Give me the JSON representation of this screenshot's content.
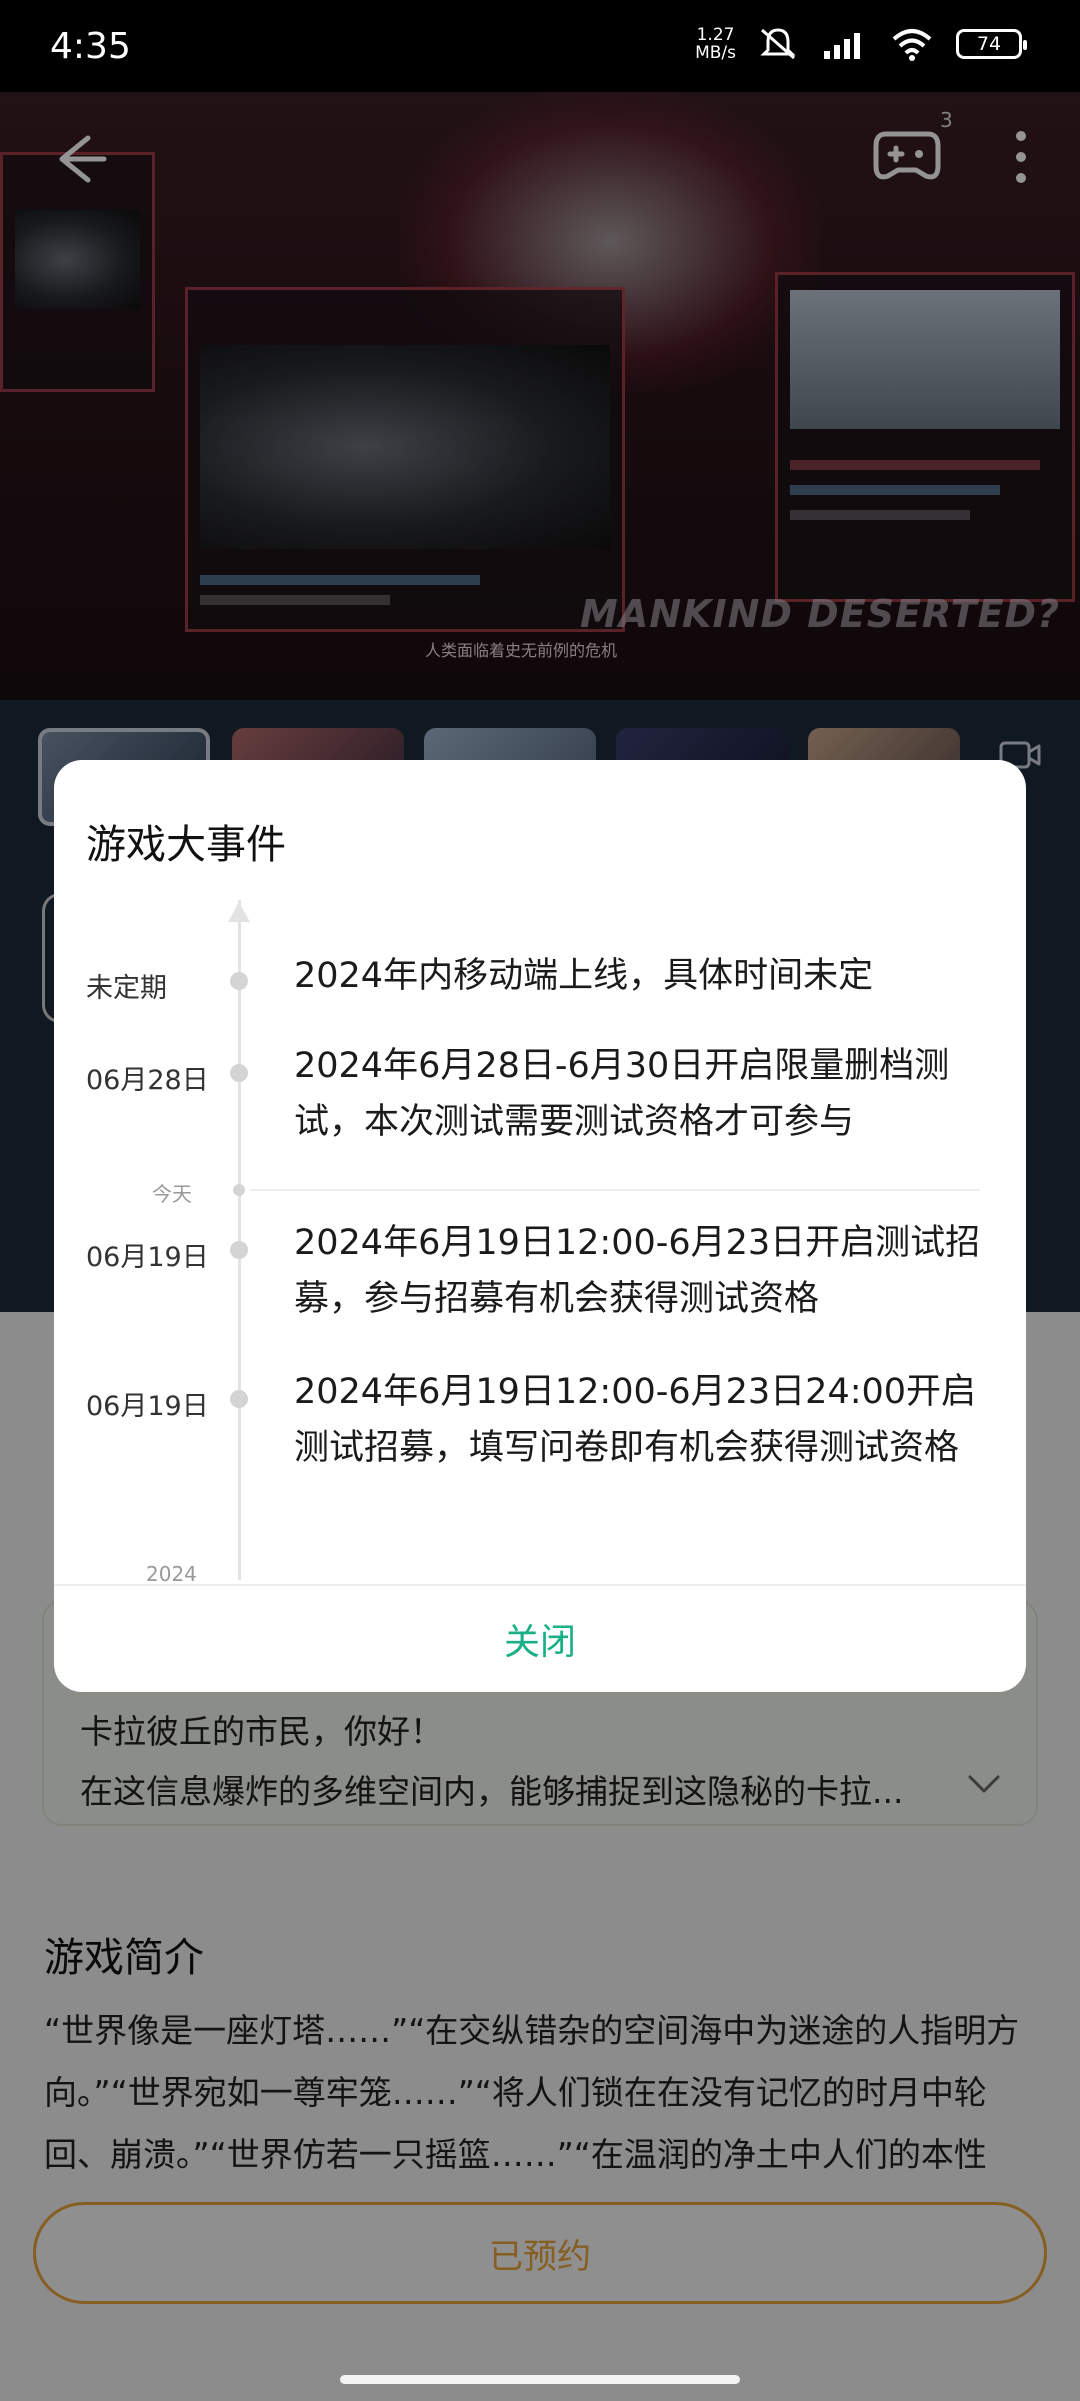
{
  "status_bar": {
    "time": "4:35",
    "net_speed_value": "1.27",
    "net_speed_unit": "MB/s",
    "battery": "74",
    "icons": [
      "mute-icon",
      "hd-signal-icon",
      "wifi-icon",
      "battery-icon"
    ]
  },
  "hero": {
    "caption": "人类面临着史无前例的危机",
    "title_art": "MANKIND DESERTED?",
    "controller_badge": "3",
    "icons": [
      "back-arrow-icon",
      "game-controller-icon",
      "more-vertical-icon"
    ]
  },
  "dialog": {
    "title": "游戏大事件",
    "events": [
      {
        "date": "未定期",
        "text": "2024年内移动端上线，具体时间未定"
      },
      {
        "date": "06月28日",
        "text": "2024年6月28日-6月30日开启限量删档测试，本次测试需要测试资格才可参与"
      },
      {
        "date": "06月19日",
        "text": "2024年6月19日12:00-6月23日开启测试招募，参与招募有机会获得测试资格"
      },
      {
        "date": "06月19日",
        "text": "2024年6月19日12:00-6月23日24:00开启测试招募，填写问卷即有机会获得测试资格"
      }
    ],
    "today_label": "今天",
    "year_label": "2024",
    "close_label": "关闭"
  },
  "page": {
    "welcome_line1": "卡拉彼丘的市民，你好！",
    "welcome_line2": "在这信息爆炸的多维空间内，能够捕捉到这隐秘的卡拉...",
    "intro_title": "游戏简介",
    "intro_body": "“世界像是一座灯塔……”“在交纵错杂的空间海中为迷途的人指明方向。”“世界宛如一尊牢笼……”“将人们锁在在没有记忆的时月中轮回、崩溃。”“世界仿若一只摇篮……”“在温润的净土中人们的本性",
    "reserve_label": "已预约"
  },
  "colors": {
    "accent_green": "#19b088",
    "reserve_orange": "#e7a23a"
  }
}
